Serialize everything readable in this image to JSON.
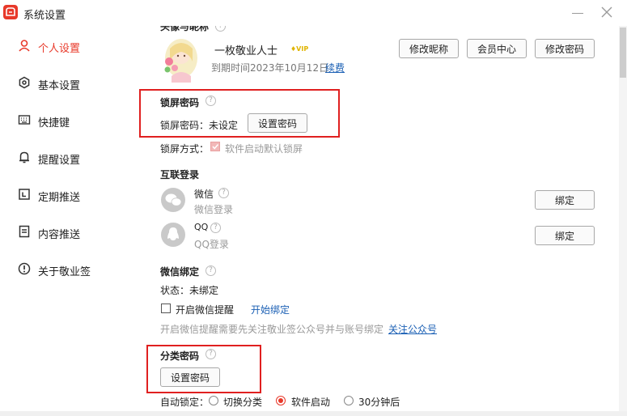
{
  "window": {
    "title": "系统设置"
  },
  "sidebar": {
    "items": [
      {
        "label": "个人设置",
        "icon": "user-icon"
      },
      {
        "label": "基本设置",
        "icon": "gear-icon"
      },
      {
        "label": "快捷键",
        "icon": "keyboard-icon"
      },
      {
        "label": "提醒设置",
        "icon": "bell-icon"
      },
      {
        "label": "定期推送",
        "icon": "calendar-icon"
      },
      {
        "label": "内容推送",
        "icon": "document-icon"
      },
      {
        "label": "关于敬业签",
        "icon": "info-icon"
      }
    ],
    "active_index": 0
  },
  "profile": {
    "section_title": "头像与昵称",
    "nickname": "一枚敬业人士",
    "vip_badge": "VIP",
    "expire_text": "到期时间2023年10月12日",
    "renew_link": "续费",
    "buttons": {
      "edit_nickname": "修改昵称",
      "member_center": "会员中心",
      "edit_password": "修改密码"
    }
  },
  "lock_password": {
    "section_title": "锁屏密码",
    "label": "锁屏密码：未设定",
    "set_button": "设置密码",
    "mode_label": "锁屏方式：",
    "mode_checkbox": "软件启动默认锁屏"
  },
  "login": {
    "section_title": "互联登录",
    "accounts": [
      {
        "name": "微信",
        "sub": "微信登录",
        "button": "绑定"
      },
      {
        "name": "QQ",
        "sub": "QQ登录",
        "button": "绑定"
      }
    ]
  },
  "wechat_bind": {
    "section_title": "微信绑定",
    "status": "状态：未绑定",
    "checkbox_label": "开启微信提醒",
    "start_link": "开始绑定",
    "note": "开启微信提醒需要先关注敬业签公众号并与账号绑定",
    "follow_link": "关注公众号"
  },
  "category_password": {
    "section_title": "分类密码",
    "set_button": "设置密码",
    "auto_lock_label": "自动锁定：",
    "options": [
      {
        "label": "切换分类",
        "selected": false
      },
      {
        "label": "软件启动",
        "selected": true
      },
      {
        "label": "30分钟后",
        "selected": false
      }
    ]
  },
  "colors": {
    "accent": "#e8392a",
    "link": "#1a5fb4",
    "highlight_box": "#e02020"
  }
}
